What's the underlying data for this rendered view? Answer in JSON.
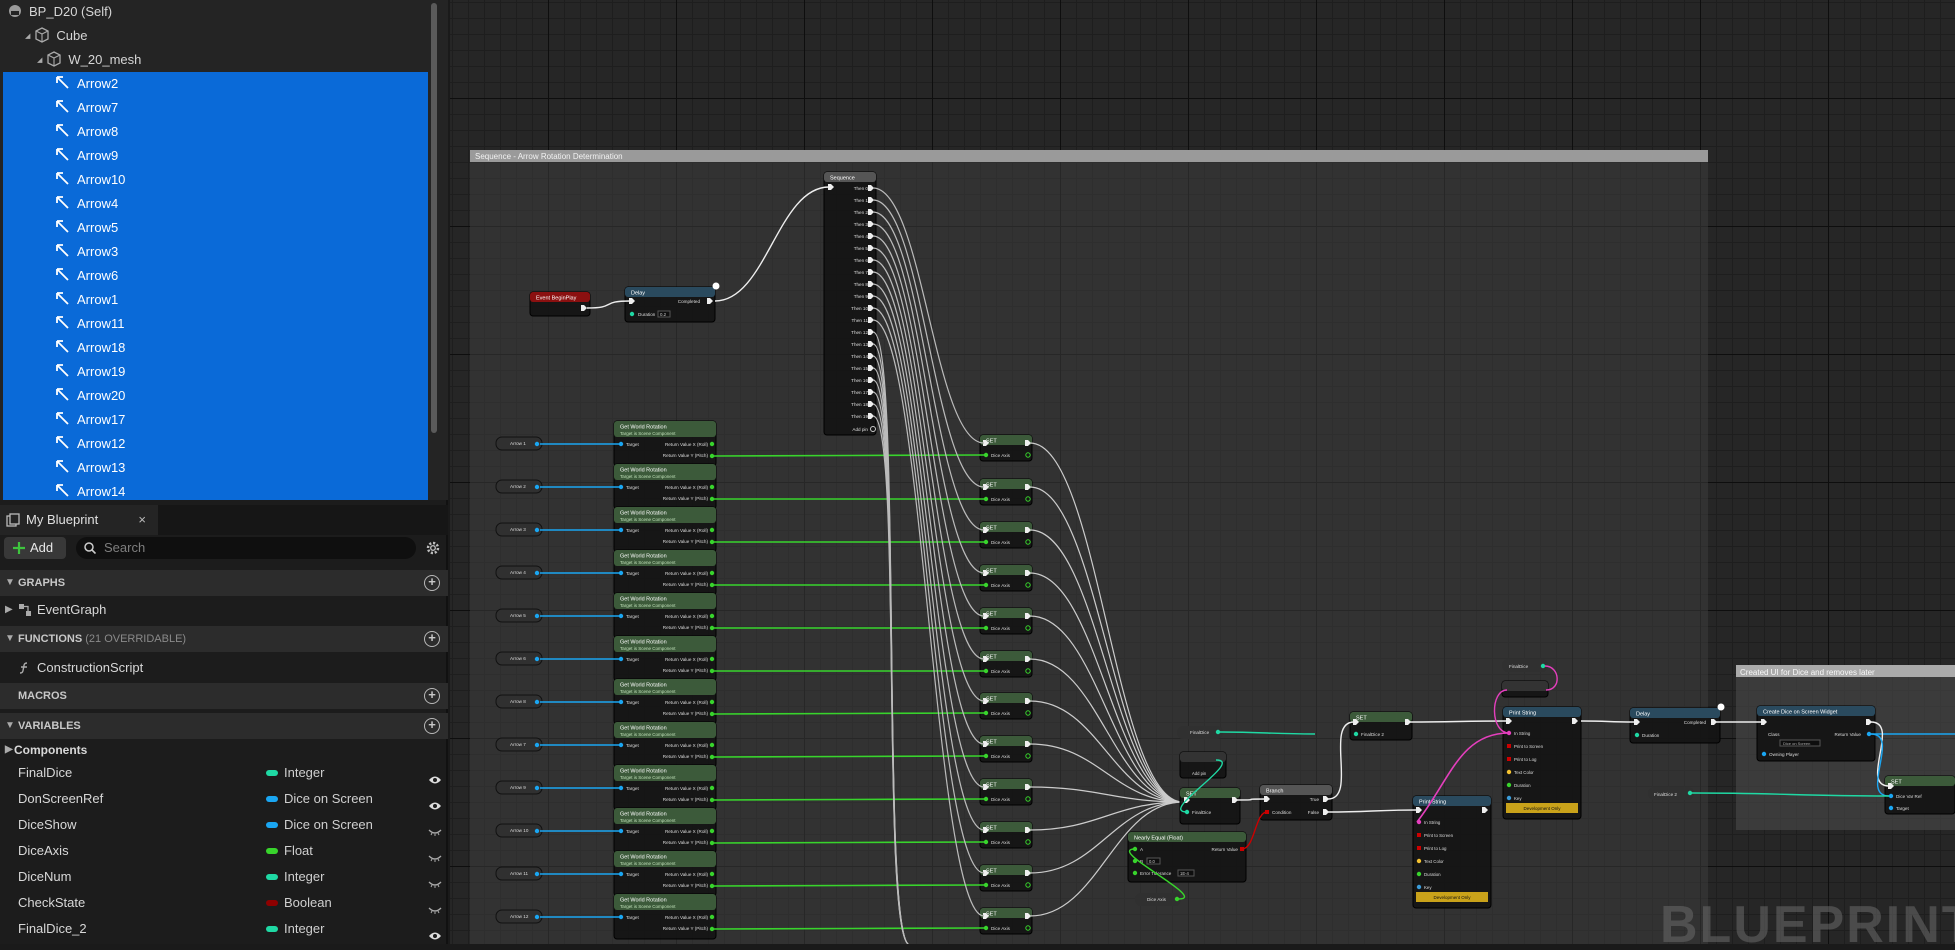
{
  "tree": {
    "root": "BP_D20 (Self)",
    "cube": "Cube",
    "mesh": "W_20_mesh",
    "arrows": [
      "Arrow2",
      "Arrow7",
      "Arrow8",
      "Arrow9",
      "Arrow10",
      "Arrow4",
      "Arrow5",
      "Arrow3",
      "Arrow6",
      "Arrow1",
      "Arrow11",
      "Arrow18",
      "Arrow19",
      "Arrow20",
      "Arrow17",
      "Arrow12",
      "Arrow13",
      "Arrow14"
    ]
  },
  "panel": {
    "tab": "My Blueprint",
    "close": "×",
    "add": "Add",
    "search_placeholder": "Search"
  },
  "sections": {
    "graphs": "GRAPHS",
    "functions": "FUNCTIONS",
    "functions_sub": "(21 OVERRIDABLE)",
    "macros": "MACROS",
    "variables": "VARIABLES",
    "components": "Components"
  },
  "items": {
    "event_graph": "EventGraph",
    "construction": "ConstructionScript"
  },
  "variables": [
    {
      "name": "FinalDice",
      "type": "Integer",
      "color": "#1fd9a4",
      "visible": true
    },
    {
      "name": "DonScreenRef",
      "type": "Dice on Screen",
      "color": "#1aa6f2",
      "visible": true
    },
    {
      "name": "DiceShow",
      "type": "Dice on Screen",
      "color": "#1aa6f2",
      "visible": false
    },
    {
      "name": "DiceAxis",
      "type": "Float",
      "color": "#38d42c",
      "visible": false
    },
    {
      "name": "DiceNum",
      "type": "Integer",
      "color": "#1fd9a4",
      "visible": false
    },
    {
      "name": "CheckState",
      "type": "Boolean",
      "color": "#8e0000",
      "visible": false
    },
    {
      "name": "FinalDice_2",
      "type": "Integer",
      "color": "#1fd9a4",
      "visible": true
    }
  ],
  "graph": {
    "comment1": "Sequence - Arrow Rotation Determination",
    "comment2": "Created UI for Dice and removes later",
    "watermark": "BLUEPRINT",
    "nodes": {
      "event": "Event BeginPlay",
      "delay": "Delay",
      "completed": "Completed",
      "duration": "Duration",
      "duration_val": "0.2",
      "sequence": "Sequence",
      "add_pin": "Add pin",
      "get_rot": "Get World Rotation",
      "get_rot_sub": "Target is Scene Component",
      "target": "Target",
      "ret_x": "Return Value X (Roll)",
      "ret_y": "Return Value Y (Pitch)",
      "set": "SET",
      "dice_axis": "Dice Axis",
      "final_dice": "FinalDice",
      "final_dice_2": "FinalDice 2",
      "add_int": "Add pin",
      "branch": "Branch",
      "condition": "Condition",
      "true": "True",
      "false": "False",
      "nearly_equal": "Nearly Equal (Float)",
      "a": "A",
      "b": "B",
      "error_tol": "Error Tolerance",
      "err_val": "1E-4",
      "b_val": "0.0",
      "return_value": "Return Value",
      "print": "Print String",
      "in_string": "In String",
      "print_screen": "Print to Screen",
      "print_log": "Print to Log",
      "text_color": "Text Color",
      "key": "Key",
      "key_val": "None",
      "dev_only": "Development Only",
      "dur_val": "2.0",
      "create_widget": "Create Dice on Screen Widget",
      "class": "Class",
      "owning_player": "Owning Player",
      "class_val": "Dice on Screen",
      "set2": "SET",
      "dice_var_ref": "Dice Var Ref",
      "target2": "Target"
    },
    "arrow_labels": [
      "Arrow 1",
      "Arrow 2",
      "Arrow 3",
      "Arrow 4",
      "Arrow 5",
      "Arrow 6",
      "Arrow 8",
      "Arrow 7",
      "Arrow 9",
      "Arrow 10",
      "Arrow 11",
      "Arrow 12"
    ],
    "then_pins": [
      "Then 0",
      "Then 1",
      "Then 2",
      "Then 3",
      "Then 4",
      "Then 5",
      "Then 6",
      "Then 7",
      "Then 8",
      "Then 9",
      "Then 10",
      "Then 11",
      "Then 12",
      "Then 13",
      "Then 14",
      "Then 15",
      "Then 16",
      "Then 17",
      "Then 18",
      "Then 19"
    ]
  }
}
